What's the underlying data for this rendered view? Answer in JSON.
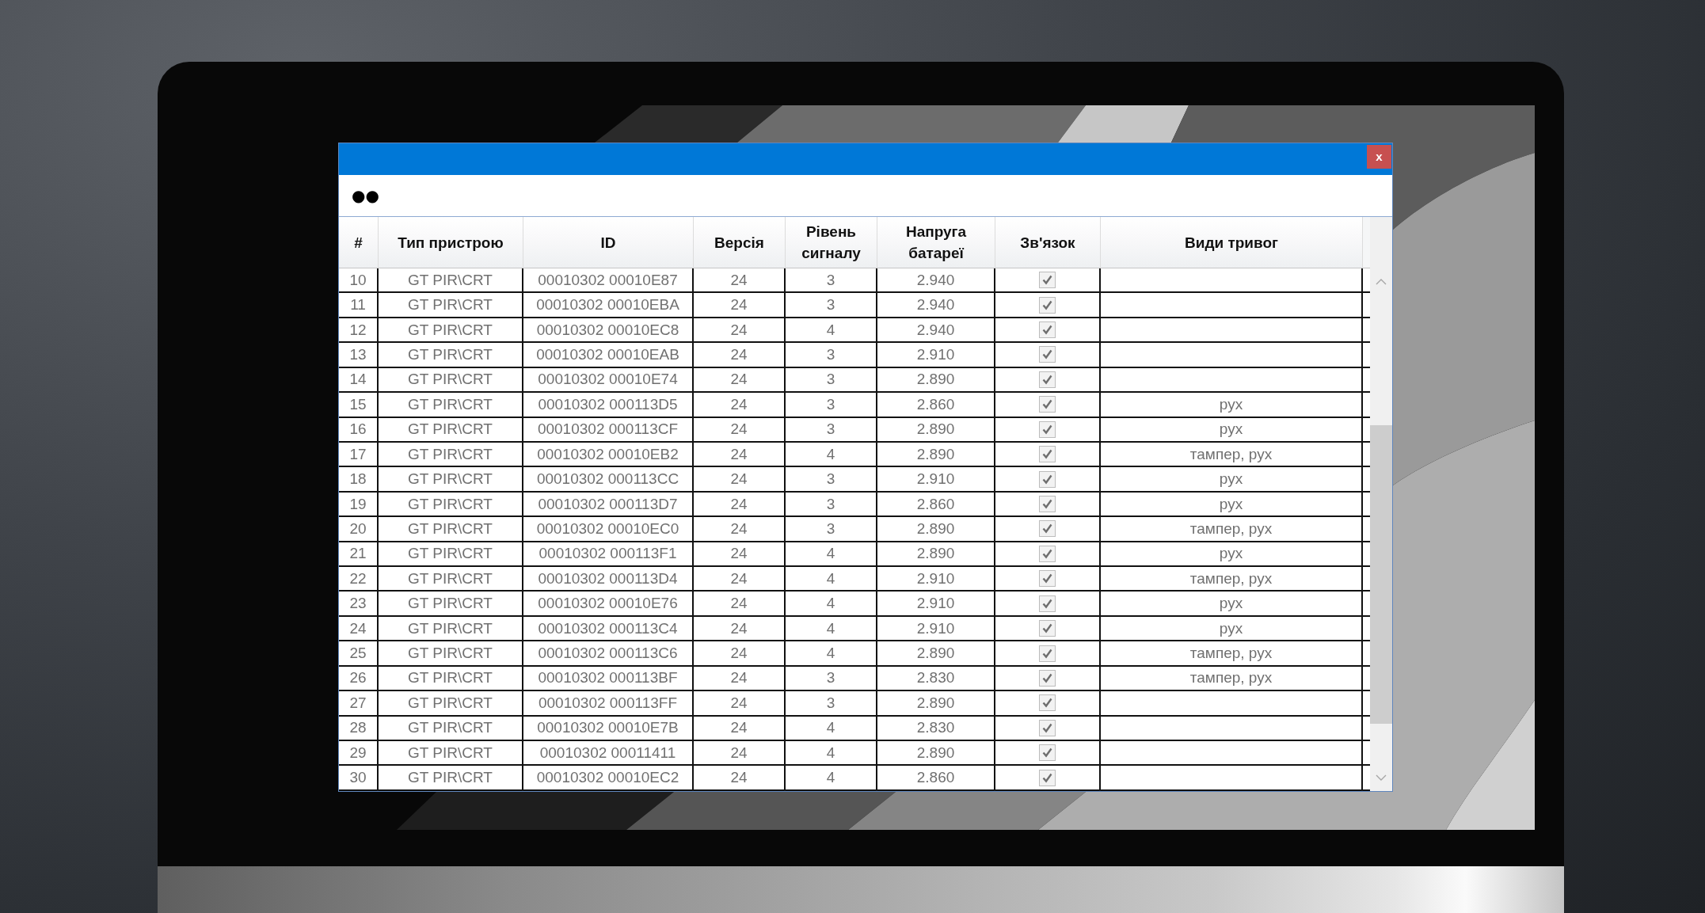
{
  "window": {
    "close_button": "x"
  },
  "toolbar": {
    "label": "●●"
  },
  "table": {
    "columns": [
      "#",
      "Тип пристрою",
      "ID",
      "Версія",
      "Рівень сигналу",
      "Напруга батареї",
      "Зв'язок",
      "Види тривог"
    ],
    "rows": [
      {
        "number": "10",
        "device_type": "GT PIR\\CRT",
        "id": "00010302 00010E87",
        "version": "24",
        "signal_level": "3",
        "battery_voltage": "2.940",
        "connection": {
          "checked": true
        }
      },
      {
        "number": "11",
        "device_type": "GT PIR\\CRT",
        "id": "00010302 00010EBA",
        "version": "24",
        "signal_level": "3",
        "battery_voltage": "2.940",
        "connection": {
          "checked": true
        }
      },
      {
        "number": "12",
        "device_type": "GT PIR\\CRT",
        "id": "00010302 00010EC8",
        "version": "24",
        "signal_level": "4",
        "battery_voltage": "2.940",
        "connection": {
          "checked": true
        }
      },
      {
        "number": "13",
        "device_type": "GT PIR\\CRT",
        "id": "00010302 00010EAB",
        "version": "24",
        "signal_level": "3",
        "battery_voltage": "2.910",
        "connection": {
          "checked": true
        }
      },
      {
        "number": "14",
        "device_type": "GT PIR\\CRT",
        "id": "00010302 00010E74",
        "version": "24",
        "signal_level": "3",
        "battery_voltage": "2.890",
        "connection": {
          "checked": true
        }
      },
      {
        "number": "15",
        "device_type": "GT PIR\\CRT",
        "id": "00010302 000113D5",
        "version": "24",
        "signal_level": "3",
        "battery_voltage": "2.860",
        "connection": {
          "checked": true
        },
        "alarm_types": "рух"
      },
      {
        "number": "16",
        "device_type": "GT PIR\\CRT",
        "id": "00010302 000113CF",
        "version": "24",
        "signal_level": "3",
        "battery_voltage": "2.890",
        "connection": {
          "checked": true
        },
        "alarm_types": "рух"
      },
      {
        "number": "17",
        "device_type": "GT PIR\\CRT",
        "id": "00010302 00010EB2",
        "version": "24",
        "signal_level": "4",
        "battery_voltage": "2.890",
        "connection": {
          "checked": true
        },
        "alarm_types": "тампер, рух"
      },
      {
        "number": "18",
        "device_type": "GT PIR\\CRT",
        "id": "00010302 000113CC",
        "version": "24",
        "signal_level": "3",
        "battery_voltage": "2.910",
        "connection": {
          "checked": true
        },
        "alarm_types": "рух"
      },
      {
        "number": "19",
        "device_type": "GT PIR\\CRT",
        "id": "00010302 000113D7",
        "version": "24",
        "signal_level": "3",
        "battery_voltage": "2.860",
        "connection": {
          "checked": true
        },
        "alarm_types": "рух"
      },
      {
        "number": "20",
        "device_type": "GT PIR\\CRT",
        "id": "00010302 00010EC0",
        "version": "24",
        "signal_level": "3",
        "battery_voltage": "2.890",
        "connection": {
          "checked": true
        },
        "alarm_types": "тампер, рух"
      },
      {
        "number": "21",
        "device_type": "GT PIR\\CRT",
        "id": "00010302 000113F1",
        "version": "24",
        "signal_level": "4",
        "battery_voltage": "2.890",
        "connection": {
          "checked": true
        },
        "alarm_types": "рух"
      },
      {
        "number": "22",
        "device_type": "GT PIR\\CRT",
        "id": "00010302 000113D4",
        "version": "24",
        "signal_level": "4",
        "battery_voltage": "2.910",
        "connection": {
          "checked": true
        },
        "alarm_types": "тампер, рух"
      },
      {
        "number": "23",
        "device_type": "GT PIR\\CRT",
        "id": "00010302 00010E76",
        "version": "24",
        "signal_level": "4",
        "battery_voltage": "2.910",
        "connection": {
          "checked": true
        },
        "alarm_types": "рух"
      },
      {
        "number": "24",
        "device_type": "GT PIR\\CRT",
        "id": "00010302 000113C4",
        "version": "24",
        "signal_level": "4",
        "battery_voltage": "2.910",
        "connection": {
          "checked": true
        },
        "alarm_types": "рух"
      },
      {
        "number": "25",
        "device_type": "GT PIR\\CRT",
        "id": "00010302 000113C6",
        "version": "24",
        "signal_level": "4",
        "battery_voltage": "2.890",
        "connection": {
          "checked": true
        },
        "alarm_types": "тампер, рух"
      },
      {
        "number": "26",
        "device_type": "GT PIR\\CRT",
        "id": "00010302 000113BF",
        "version": "24",
        "signal_level": "3",
        "battery_voltage": "2.830",
        "connection": {
          "checked": true
        },
        "alarm_types": "тампер, рух"
      },
      {
        "number": "27",
        "device_type": "GT PIR\\CRT",
        "id": "00010302 000113FF",
        "version": "24",
        "signal_level": "3",
        "battery_voltage": "2.890",
        "connection": {
          "checked": true
        }
      },
      {
        "number": "28",
        "device_type": "GT PIR\\CRT",
        "id": "00010302 00010E7B",
        "version": "24",
        "signal_level": "4",
        "battery_voltage": "2.830",
        "connection": {
          "checked": true
        }
      },
      {
        "number": "29",
        "device_type": "GT PIR\\CRT",
        "id": "00010302 00011411",
        "version": "24",
        "signal_level": "4",
        "battery_voltage": "2.890",
        "connection": {
          "checked": true
        }
      },
      {
        "number": "30",
        "device_type": "GT PIR\\CRT",
        "id": "00010302 00010EC2",
        "version": "24",
        "signal_level": "4",
        "battery_voltage": "2.860",
        "connection": {
          "checked": true
        }
      }
    ]
  }
}
